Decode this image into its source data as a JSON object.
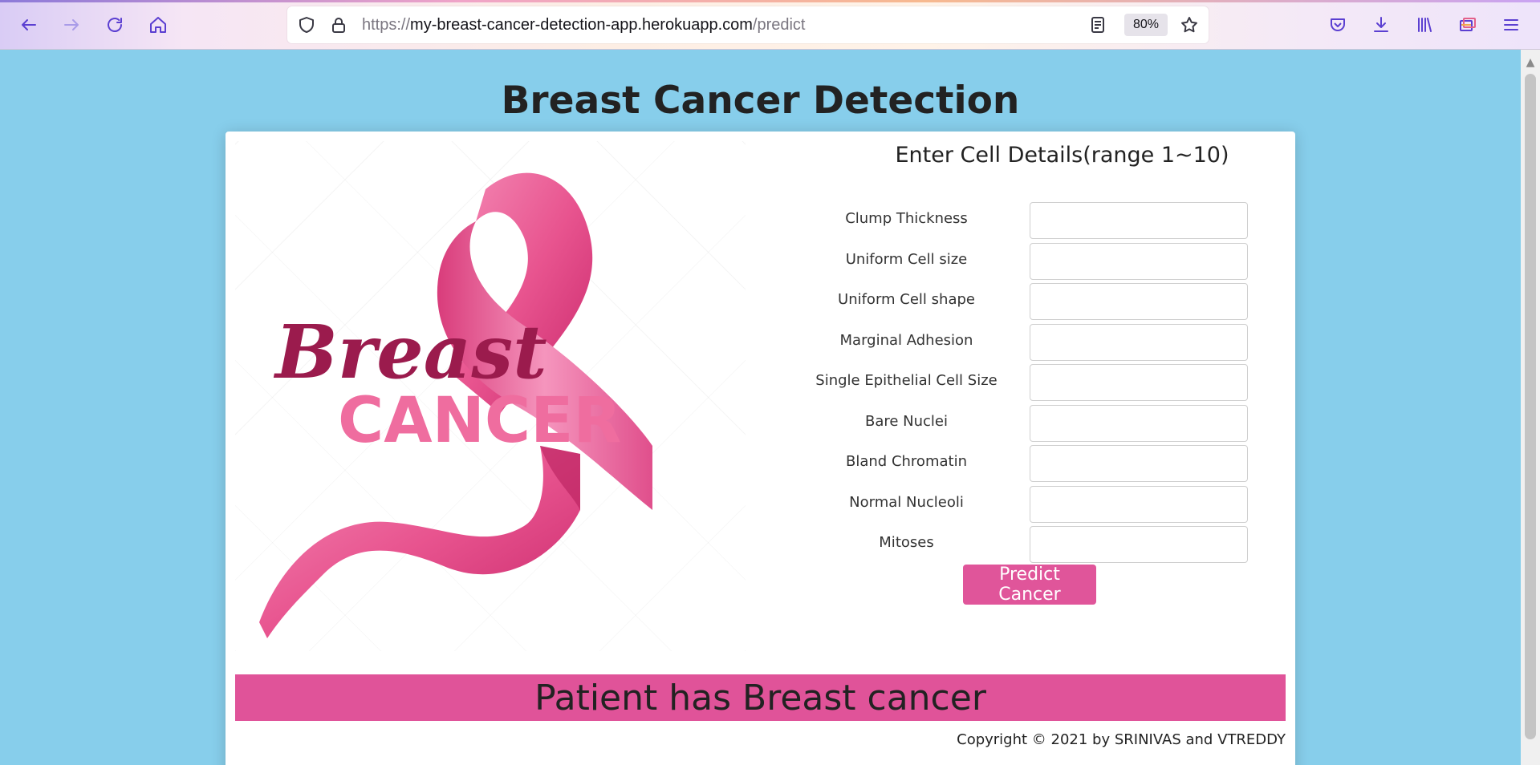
{
  "browser": {
    "url_scheme": "https://",
    "url_host": "my-breast-cancer-detection-app.herokuapp.com",
    "url_path": "/predict",
    "zoom": "80%",
    "icons": {
      "back": "arrow-left",
      "forward": "arrow-right",
      "reload": "reload",
      "home": "home",
      "tracking": "shield",
      "security": "lock",
      "reader": "reader-view",
      "bookmark": "star",
      "pocket": "pocket",
      "downloads": "download",
      "library": "library",
      "synced_tabs": "synced-tabs",
      "menu": "hamburger-menu"
    },
    "accent_color": "#5b3fd1"
  },
  "page": {
    "title": "Breast Cancer Detection",
    "background_color": "#87ceeb",
    "image": {
      "word_script": "Breast",
      "word_caps": "CANCER",
      "ribbon_color": "#e8548f",
      "text_dark_color": "#9b1b4d",
      "text_light_color": "#ef6d9f"
    },
    "form": {
      "heading": "Enter Cell Details(range 1~10)",
      "fields": [
        {
          "label": "Clump Thickness",
          "value": ""
        },
        {
          "label": "Uniform Cell size",
          "value": ""
        },
        {
          "label": "Uniform Cell shape",
          "value": ""
        },
        {
          "label": "Marginal Adhesion",
          "value": ""
        },
        {
          "label": "Single Epithelial Cell Size",
          "value": ""
        },
        {
          "label": "Bare Nuclei",
          "value": ""
        },
        {
          "label": "Bland Chromatin",
          "value": ""
        },
        {
          "label": "Normal Nucleoli",
          "value": ""
        },
        {
          "label": "Mitoses",
          "value": ""
        }
      ],
      "submit_label": "Predict Cancer",
      "submit_color": "#e0559a"
    },
    "result": {
      "text": "Patient has Breast cancer",
      "color": "#e05399"
    },
    "footer": {
      "copyright": "Copyright © 2021 by SRINIVAS and VTREDDY"
    }
  }
}
